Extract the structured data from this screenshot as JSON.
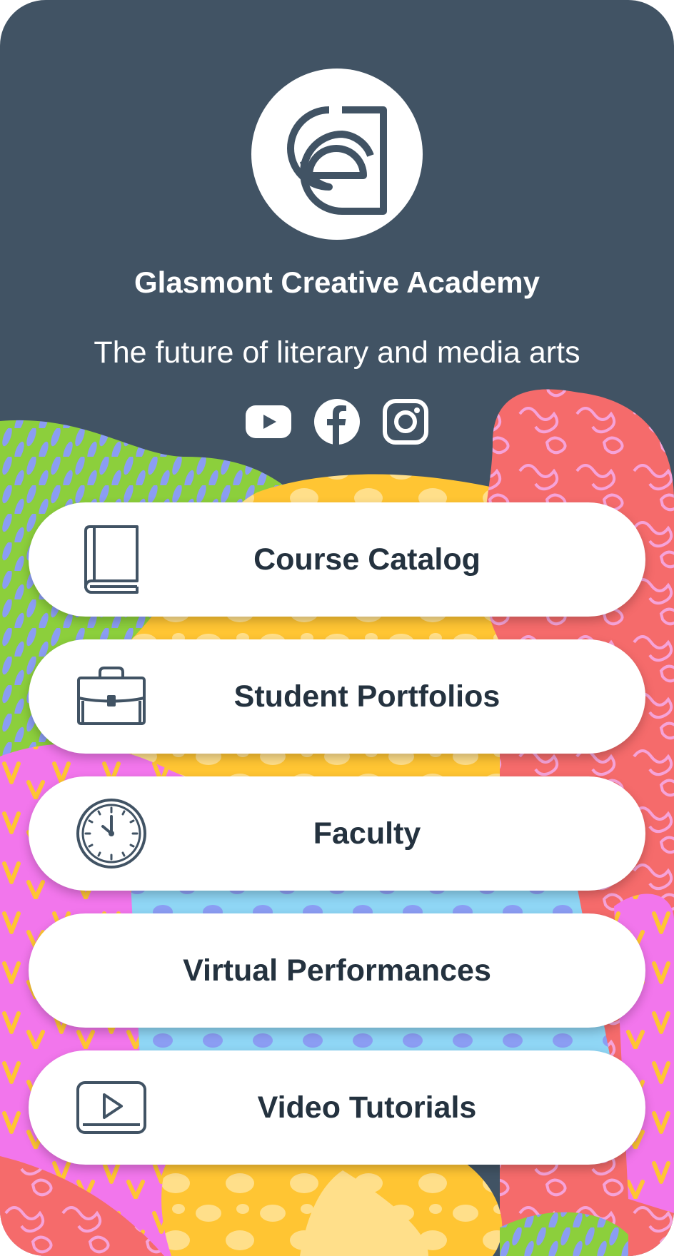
{
  "profile": {
    "name": "Glasmont Creative Academy",
    "tagline": "The future of literary and media arts",
    "logo_icon": "academy-logo-icon"
  },
  "socials": [
    {
      "name": "youtube",
      "icon": "youtube-icon"
    },
    {
      "name": "facebook",
      "icon": "facebook-icon"
    },
    {
      "name": "instagram",
      "icon": "instagram-icon"
    }
  ],
  "links": [
    {
      "label": "Course Catalog",
      "icon": "book-icon"
    },
    {
      "label": "Student Portfolios",
      "icon": "briefcase-icon"
    },
    {
      "label": "Faculty",
      "icon": "clock-icon"
    },
    {
      "label": "Virtual Performances",
      "icon": ""
    },
    {
      "label": "Video Tutorials",
      "icon": "play-video-icon"
    }
  ],
  "colors": {
    "header": "#415364",
    "button_text": "#24323f",
    "green": "#8ccf3c",
    "periwinkle": "#8b9df3",
    "yellow": "#ffc533",
    "coral": "#f56b6b",
    "pink": "#f276ec",
    "sky": "#8fd6f5",
    "peach": "#ffdf8a"
  }
}
